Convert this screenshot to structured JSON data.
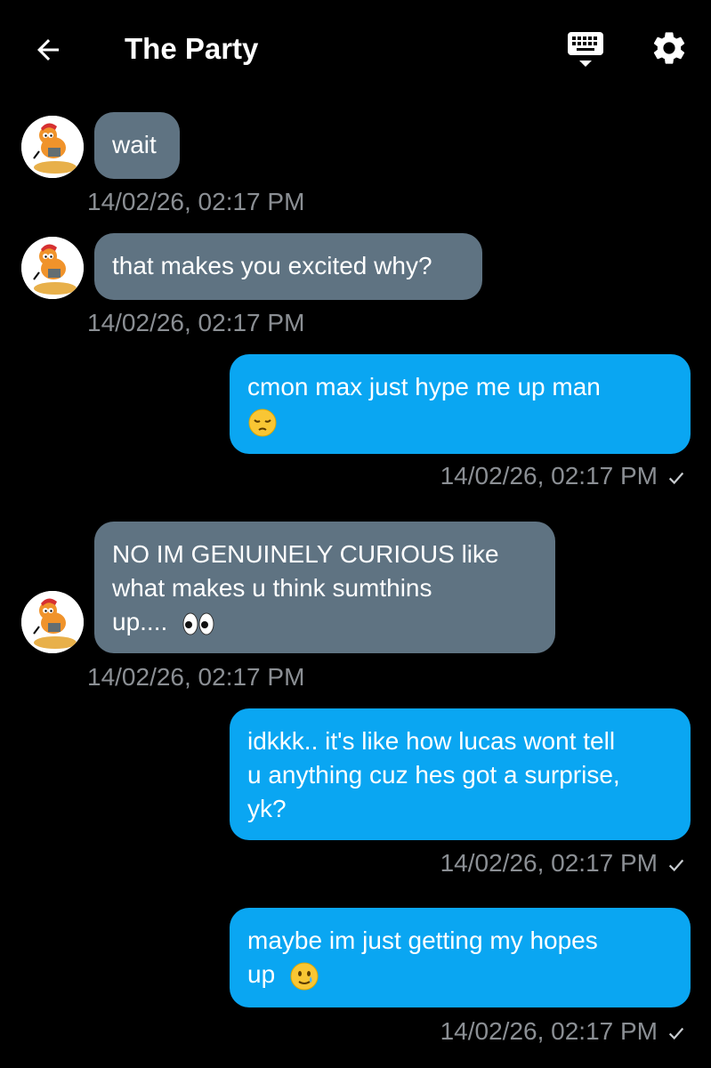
{
  "header": {
    "title": "The Party",
    "back_icon": "arrow-left-icon",
    "keyboard_icon": "keyboard-hide-icon",
    "settings_icon": "gear-icon"
  },
  "colors": {
    "background": "#000000",
    "incoming_bubble": "#5f7382",
    "outgoing_bubble": "#0aa6f2",
    "timestamp": "#8b8f94"
  },
  "messages": [
    {
      "direction": "incoming",
      "text": "wait",
      "time": "14/02/26, 02:17 PM"
    },
    {
      "direction": "incoming",
      "text": "that makes you excited why?",
      "time": "14/02/26, 02:17 PM"
    },
    {
      "direction": "outgoing",
      "text": "cmon max just hype me up man",
      "emoji": "pensive-face-emoji",
      "time": "14/02/26, 02:17 PM",
      "status": "sent-checkmark"
    },
    {
      "direction": "incoming",
      "text_lines": [
        "NO IM GENUINELY CURIOUS like",
        "what makes u think sumthins",
        "up...."
      ],
      "emoji": "eyes-emoji",
      "time": "14/02/26, 02:17 PM"
    },
    {
      "direction": "outgoing",
      "text_lines": [
        "idkkk.. it's like how lucas wont tell",
        "u anything cuz hes got a surprise,",
        "yk?"
      ],
      "time": "14/02/26, 02:17 PM",
      "status": "sent-checkmark"
    },
    {
      "direction": "outgoing",
      "text_lines": [
        "maybe im just getting my hopes",
        "up"
      ],
      "emoji": "smiling-face-with-tear-emoji",
      "time": "14/02/26, 02:17 PM",
      "status": "sent-checkmark"
    }
  ]
}
